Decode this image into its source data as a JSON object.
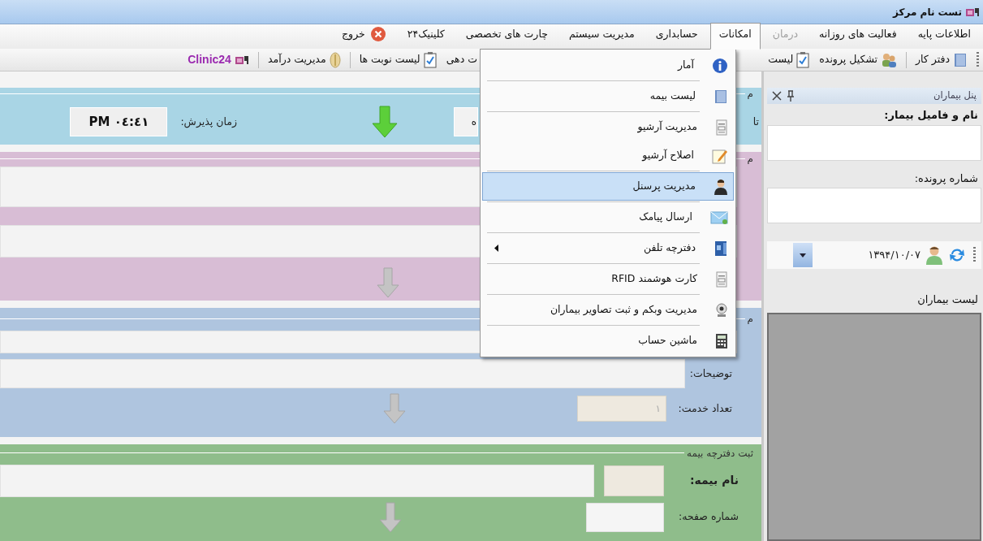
{
  "window": {
    "title": "تست نام مرکز"
  },
  "menu_bar": [
    {
      "label": "اطلاعات پایه",
      "kind": "text",
      "selected": false,
      "disabled": false
    },
    {
      "label": "فعالیت های روزانه",
      "kind": "text",
      "selected": false,
      "disabled": false
    },
    {
      "label": "درمان",
      "kind": "text",
      "selected": false,
      "disabled": true
    },
    {
      "label": "امکانات",
      "kind": "text",
      "selected": true,
      "disabled": false
    },
    {
      "label": "حسابداری",
      "kind": "text",
      "selected": false,
      "disabled": false
    },
    {
      "label": "مدیریت سیستم",
      "kind": "text",
      "selected": false,
      "disabled": false
    },
    {
      "label": "چارت های تخصصی",
      "kind": "text",
      "selected": false,
      "disabled": false
    },
    {
      "label": "کلینیک۲۴",
      "kind": "text",
      "selected": false,
      "disabled": false
    },
    {
      "label": "خروج",
      "kind": "exit",
      "selected": false,
      "disabled": false
    }
  ],
  "toolbar": {
    "right_items": [
      {
        "kind": "button",
        "label": "دفتر کار"
      },
      {
        "kind": "separator"
      },
      {
        "kind": "button",
        "label": "تشکیل پرونده"
      },
      {
        "kind": "button",
        "label": "لیست"
      }
    ],
    "left_items": [
      {
        "kind": "partial",
        "label": "ت دهی"
      },
      {
        "kind": "button",
        "label": "لیست نوبت ها"
      },
      {
        "kind": "separator"
      },
      {
        "kind": "button",
        "label": "مدیریت درآمد"
      },
      {
        "kind": "separator"
      },
      {
        "kind": "brand",
        "label": "Clinic24"
      }
    ]
  },
  "dropdown_menu": {
    "items": [
      {
        "kind": "item",
        "label": "آمار",
        "selected": false,
        "submenu": false
      },
      {
        "kind": "separator"
      },
      {
        "kind": "item",
        "label": "لیست بیمه",
        "selected": false,
        "submenu": false
      },
      {
        "kind": "separator"
      },
      {
        "kind": "item",
        "label": "مدیریت آرشیو",
        "selected": false,
        "submenu": false
      },
      {
        "kind": "item",
        "label": "اصلاح آرشیو",
        "selected": false,
        "submenu": false
      },
      {
        "kind": "separator"
      },
      {
        "kind": "item",
        "label": "مدیریت پرسنل",
        "selected": true,
        "submenu": false
      },
      {
        "kind": "separator"
      },
      {
        "kind": "item",
        "label": "ارسال پیامک",
        "selected": false,
        "submenu": false
      },
      {
        "kind": "separator"
      },
      {
        "kind": "item",
        "label": "دفترچه تلفن",
        "selected": false,
        "submenu": true
      },
      {
        "kind": "separator"
      },
      {
        "kind": "item",
        "label": "کارت هوشمند RFID",
        "selected": false,
        "submenu": false
      },
      {
        "kind": "separator"
      },
      {
        "kind": "item",
        "label": "مدیریت وبکم و ثبت تصاویر بیماران",
        "selected": false,
        "submenu": false
      },
      {
        "kind": "separator"
      },
      {
        "kind": "item",
        "label": "ماشین حساب",
        "selected": false,
        "submenu": false
      }
    ]
  },
  "admission": {
    "legend": "م",
    "label_partial": "تا",
    "field_partial": "ه",
    "time_label": "زمان پذیرش:",
    "time_value": "۰٤:٤١ PM"
  },
  "services": {
    "legend": "م"
  },
  "details": {
    "legend": "م",
    "notes_label": "توضیحات:",
    "count_label": "تعداد خدمت:",
    "count_value": "۱"
  },
  "insurance": {
    "legend": "ثبت دفترچه بیمه",
    "name_label": "نام بیمه:",
    "page_label": "شماره صفحه:"
  },
  "patient_panel": {
    "title": "پنل بیماران",
    "name_label": "نام و فامیل بیمار:",
    "file_label": "شماره پرونده:",
    "date": "۱۳۹۴/۱۰/۰۷",
    "list_label": "لیست بیماران"
  }
}
